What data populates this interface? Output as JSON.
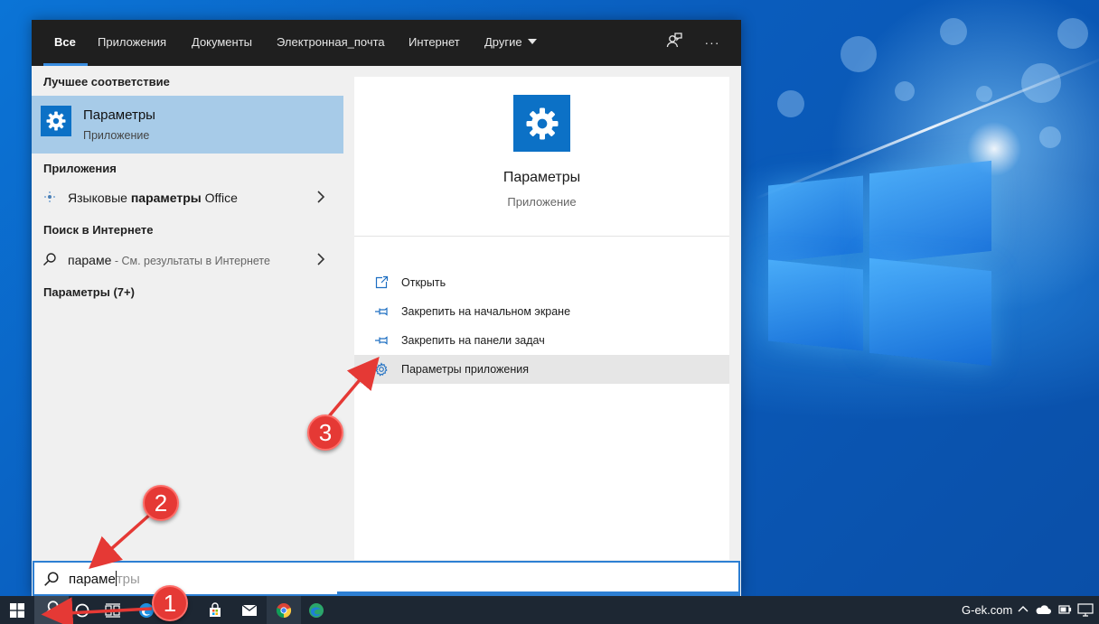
{
  "colors": {
    "accent": "#0c71c6",
    "selected_row": "#a7cbe8",
    "tabbar_bg": "#1f1f1f",
    "taskbar_bg": "#1d2733",
    "annotation_red": "#e53935"
  },
  "tabs": [
    {
      "label": "Все",
      "active": true
    },
    {
      "label": "Приложения"
    },
    {
      "label": "Документы"
    },
    {
      "label": "Электронная_почта"
    },
    {
      "label": "Интернет"
    },
    {
      "label": "Другие"
    }
  ],
  "toolbar": {
    "feedback_icon": "feedback-icon",
    "more_label": "···"
  },
  "left": {
    "best_match_header": "Лучшее соответствие",
    "best_match": {
      "title": "Параметры",
      "subtitle": "Приложение",
      "icon": "gear-icon"
    },
    "apps_header": "Приложения",
    "app_item": {
      "pre": "Языковые ",
      "bold": "параметры",
      "post": " Office",
      "icon": "office-language-icon"
    },
    "web_header": "Поиск в Интернете",
    "web_item": {
      "query": "параме",
      "suffix": " - См. результаты в Интернете",
      "icon": "search-icon"
    },
    "settings_header": "Параметры (7+)"
  },
  "preview": {
    "title": "Параметры",
    "subtitle": "Приложение",
    "actions": [
      {
        "label": "Открыть",
        "icon": "open-icon"
      },
      {
        "label": "Закрепить на начальном экране",
        "icon": "pin-icon"
      },
      {
        "label": "Закрепить на панели задач",
        "icon": "pin-icon"
      },
      {
        "label": "Параметры приложения",
        "icon": "gear-icon",
        "highlighted": true
      }
    ]
  },
  "search": {
    "typed": "параме",
    "hint": "тры"
  },
  "taskbar": {
    "icons": [
      "windows-start-icon",
      "search-icon",
      "cortana-icon",
      "task-view-icon",
      "edge-icon",
      "store-icon",
      "mail-icon",
      "chrome-icon",
      "edge-beta-icon"
    ],
    "tray_text": "G-ek.com",
    "tray_icons": [
      "chevron-up-icon",
      "onedrive-icon",
      "battery-icon",
      "network-icon"
    ]
  },
  "annotations": [
    {
      "number": "1"
    },
    {
      "number": "2"
    },
    {
      "number": "3"
    }
  ]
}
